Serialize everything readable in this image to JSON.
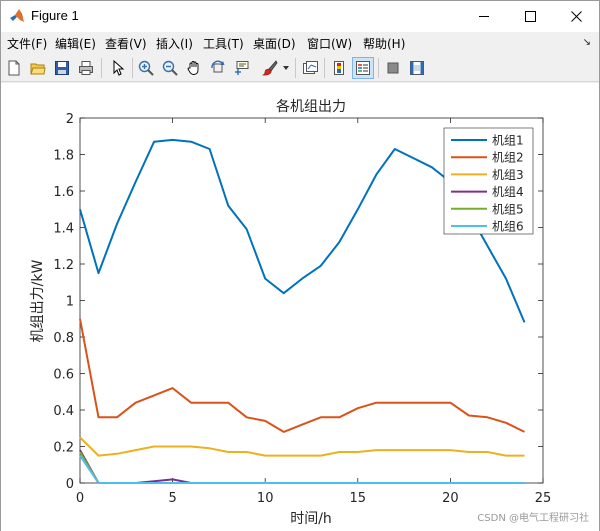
{
  "window": {
    "title": "Figure 1",
    "controls": {
      "minimize": "minimize",
      "maximize": "maximize",
      "close": "close"
    }
  },
  "menu": {
    "items": [
      {
        "label": "文件(F)"
      },
      {
        "label": "编辑(E)"
      },
      {
        "label": "查看(V)"
      },
      {
        "label": "插入(I)"
      },
      {
        "label": "工具(T)"
      },
      {
        "label": "桌面(D)"
      },
      {
        "label": "窗口(W)"
      },
      {
        "label": "帮助(H)"
      }
    ],
    "pin_icon": "dock-arrow-icon"
  },
  "toolbar": {
    "buttons": [
      {
        "icon": "new-figure-icon"
      },
      {
        "icon": "open-file-icon"
      },
      {
        "icon": "save-icon"
      },
      {
        "icon": "print-icon"
      },
      {
        "icon": "pointer-icon"
      },
      {
        "icon": "zoom-in-icon"
      },
      {
        "icon": "zoom-out-icon"
      },
      {
        "icon": "pan-hand-icon"
      },
      {
        "icon": "rotate-3d-icon"
      },
      {
        "icon": "data-cursor-icon"
      },
      {
        "icon": "brush-icon"
      },
      {
        "icon": "link-plot-icon"
      },
      {
        "icon": "colorbar-icon"
      },
      {
        "icon": "legend-icon"
      },
      {
        "icon": "hide-plot-tools-icon"
      },
      {
        "icon": "show-plot-tools-icon"
      }
    ]
  },
  "watermark": "CSDN @电气工程研习社",
  "colors": {
    "series1": "#0072BD",
    "series2": "#D95319",
    "series3": "#EDB120",
    "series4": "#7E2F8E",
    "series5": "#77AC30",
    "series6": "#4DBEEE"
  },
  "chart_data": {
    "type": "line",
    "title": "各机组出力",
    "xlabel": "时间/h",
    "ylabel": "机组出力/kW",
    "xlim": [
      0,
      25
    ],
    "ylim": [
      0,
      2
    ],
    "xticks": [
      0,
      5,
      10,
      15,
      20,
      25
    ],
    "yticks": [
      0,
      0.2,
      0.4,
      0.6,
      0.8,
      1,
      1.2,
      1.4,
      1.6,
      1.8,
      2
    ],
    "xtick_labels": [
      "0",
      "5",
      "10",
      "15",
      "20",
      "25"
    ],
    "ytick_labels": [
      "0",
      "0.2",
      "0.4",
      "0.6",
      "0.8",
      "1",
      "1.2",
      "1.4",
      "1.6",
      "1.8",
      "2"
    ],
    "grid": false,
    "legend_position": "top-right",
    "x": [
      0,
      1,
      2,
      3,
      4,
      5,
      6,
      7,
      8,
      9,
      10,
      11,
      12,
      13,
      14,
      15,
      16,
      17,
      18,
      19,
      20,
      21,
      22,
      23,
      24
    ],
    "series": [
      {
        "name": "机组1",
        "color": "#0072BD",
        "values": [
          1.5,
          1.15,
          1.42,
          1.65,
          1.87,
          1.88,
          1.87,
          1.83,
          1.52,
          1.39,
          1.12,
          1.04,
          1.12,
          1.19,
          1.32,
          1.5,
          1.69,
          1.83,
          1.78,
          1.73,
          1.65,
          1.48,
          1.3,
          1.12,
          0.88
        ]
      },
      {
        "name": "机组2",
        "color": "#D95319",
        "values": [
          0.9,
          0.36,
          0.36,
          0.44,
          0.48,
          0.52,
          0.44,
          0.44,
          0.44,
          0.36,
          0.34,
          0.28,
          0.32,
          0.36,
          0.36,
          0.41,
          0.44,
          0.44,
          0.44,
          0.44,
          0.44,
          0.37,
          0.36,
          0.33,
          0.28
        ]
      },
      {
        "name": "机组3",
        "color": "#EDB120",
        "values": [
          0.25,
          0.15,
          0.16,
          0.18,
          0.2,
          0.2,
          0.2,
          0.19,
          0.17,
          0.17,
          0.15,
          0.15,
          0.15,
          0.15,
          0.17,
          0.17,
          0.18,
          0.18,
          0.18,
          0.18,
          0.18,
          0.17,
          0.17,
          0.15,
          0.15
        ]
      },
      {
        "name": "机组4",
        "color": "#7E2F8E",
        "values": [
          0.18,
          0,
          0,
          0,
          0.01,
          0.02,
          0,
          0,
          0,
          0,
          0,
          0,
          0,
          0,
          0,
          0,
          0,
          0,
          0,
          0,
          0,
          0,
          0,
          0,
          0
        ]
      },
      {
        "name": "机组5",
        "color": "#77AC30",
        "values": [
          0.17,
          0,
          0,
          0,
          0,
          0,
          0,
          0,
          0,
          0,
          0,
          0,
          0,
          0,
          0,
          0,
          0,
          0,
          0,
          0,
          0,
          0,
          0,
          0,
          0
        ]
      },
      {
        "name": "机组6",
        "color": "#4DBEEE",
        "values": [
          0.15,
          0,
          0,
          0,
          0,
          0,
          0,
          0,
          0,
          0,
          0,
          0,
          0,
          0,
          0,
          0,
          0,
          0,
          0,
          0,
          0,
          0,
          0,
          0,
          0
        ]
      }
    ]
  }
}
